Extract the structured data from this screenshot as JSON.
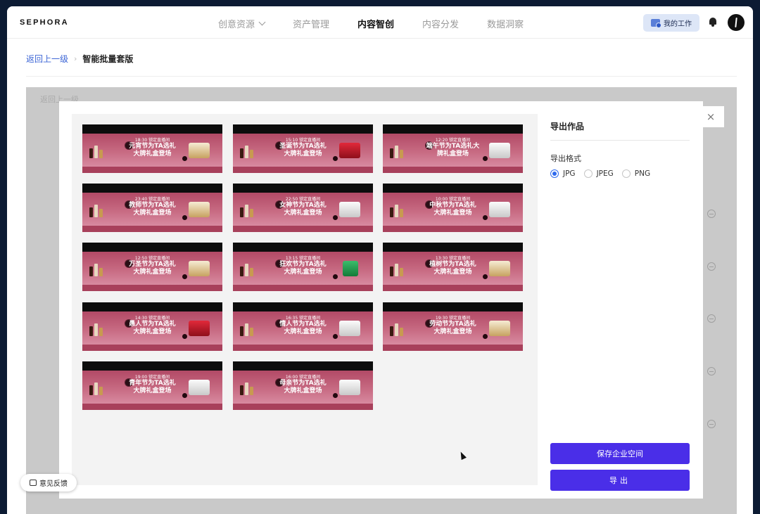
{
  "brand": "SEPHORA",
  "nav": {
    "items": [
      {
        "label": "创意资源",
        "dropdown": true,
        "active": false
      },
      {
        "label": "资产管理",
        "dropdown": false,
        "active": false
      },
      {
        "label": "内容智创",
        "dropdown": false,
        "active": true
      },
      {
        "label": "内容分发",
        "dropdown": false,
        "active": false
      },
      {
        "label": "数据洞察",
        "dropdown": false,
        "active": false
      }
    ],
    "my_work": "我的工作"
  },
  "breadcrumb": {
    "back": "返回上一级",
    "current": "智能批量套版"
  },
  "background": {
    "back_ghost": "返回上一级"
  },
  "modal": {
    "close": "×",
    "panel_title": "导出作品",
    "format_label": "导出格式",
    "formats": [
      {
        "label": "JPG",
        "selected": true
      },
      {
        "label": "JPEG",
        "selected": false
      },
      {
        "label": "PNG",
        "selected": false
      }
    ],
    "save_button": "保存企业空间",
    "export_button": "导出"
  },
  "banners": [
    {
      "time": "18:30 锁定直播间",
      "title1": "元宵节为TA选礼",
      "title2": "大牌礼盒登场",
      "product": "gold"
    },
    {
      "time": "15:10 锁定直播间",
      "title1": "圣诞节为TA选礼",
      "title2": "大牌礼盒登场",
      "product": "red"
    },
    {
      "time": "12:20 锁定直播间",
      "title1": "端午节为TA选礼大",
      "title2": "牌礼盒登场",
      "product": "white"
    },
    {
      "time": "23:40 锁定直播间",
      "title1": "教师节为TA选礼",
      "title2": "大牌礼盒登场",
      "product": "gold"
    },
    {
      "time": "22:50 锁定直播间",
      "title1": "女神节为TA选礼",
      "title2": "大牌礼盒登场",
      "product": "white"
    },
    {
      "time": "10:00 锁定直播间",
      "title1": "中秋节为TA选礼",
      "title2": "大牌礼盒登场",
      "product": "white"
    },
    {
      "time": "12:50 锁定直播间",
      "title1": "万圣节为TA选礼",
      "title2": "大牌礼盒登场",
      "product": "gold"
    },
    {
      "time": "13:15 锁定直播间",
      "title1": "狂欢节为TA选礼",
      "title2": "大牌礼盒登场",
      "product": "green"
    },
    {
      "time": "13:30 锁定直播间",
      "title1": "植树节为TA选礼",
      "title2": "大牌礼盒登场",
      "product": "gold"
    },
    {
      "time": "14:30 锁定直播间",
      "title1": "愚人节为TA选礼",
      "title2": "大牌礼盒登场",
      "product": "red"
    },
    {
      "time": "16:35 锁定直播间",
      "title1": "情人节为TA选礼",
      "title2": "大牌礼盒登场",
      "product": "white"
    },
    {
      "time": "19:30 锁定直播间",
      "title1": "劳动节为TA选礼",
      "title2": "大牌礼盒登场",
      "product": "gold"
    },
    {
      "time": "19:00 锁定直播间",
      "title1": "青年节为TA选礼",
      "title2": "大牌礼盒登场",
      "product": "white"
    },
    {
      "time": "16:00 锁定直播间",
      "title1": "母亲节为TA选礼",
      "title2": "大牌礼盒登场",
      "product": "white"
    }
  ],
  "feedback": "意见反馈",
  "colors": {
    "accent": "#4a2ee8",
    "radio": "#2f6bed",
    "banner": "#b24a66",
    "link": "#3d66d6"
  }
}
